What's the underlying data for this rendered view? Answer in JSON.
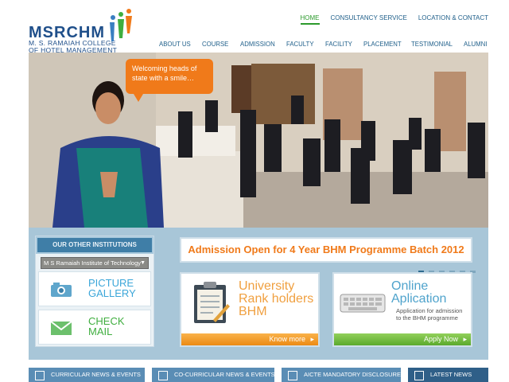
{
  "header": {
    "logo_text": "MSRCHM",
    "logo_sub1": "M. S. RAMAIAH COLLEGE",
    "logo_sub2": "OF HOTEL MANAGEMENT"
  },
  "topnav": [
    "HOME",
    "CONSULTANCY SERVICE",
    "LOCATION & CONTACT"
  ],
  "mainnav": [
    "ABOUT US",
    "COURSE",
    "ADMISSION",
    "FACULTY",
    "FACILITY",
    "PLACEMENT",
    "TESTIMONIAL",
    "ALUMNI"
  ],
  "banner": {
    "bubble": "Welcoming heads of state with a smile…"
  },
  "institutions": {
    "heading": "OUR OTHER INSTITUTIONS",
    "selected": "M S Ramaiah Institute of Technology"
  },
  "tiles": {
    "gallery_line1": "PICTURE",
    "gallery_line2": "GALLERY",
    "mail_line1": "CHECK",
    "mail_line2": "MAIL"
  },
  "admission": "Admission Open for 4 Year BHM Programme Batch 2012",
  "rank": {
    "line1": "University",
    "line2": "Rank holders",
    "line3": "BHM",
    "cta": "Know more"
  },
  "online": {
    "line1": "Online",
    "line2": "Aplication",
    "desc1": "Application for admission",
    "desc2": "to the BHM programme",
    "cta": "Apply Now"
  },
  "bottom_tabs": [
    "CURRICULAR NEWS & EVENTS",
    "CO-CURRICULAR NEWS & EVENTS",
    "AICTE MANDATORY DISCLOSURE",
    "LATEST NEWS"
  ],
  "colors": {
    "brand": "#1f4f8a",
    "accent_orange": "#f07a1a",
    "accent_green": "#5aa92c",
    "frame": "#a8c6d8"
  }
}
